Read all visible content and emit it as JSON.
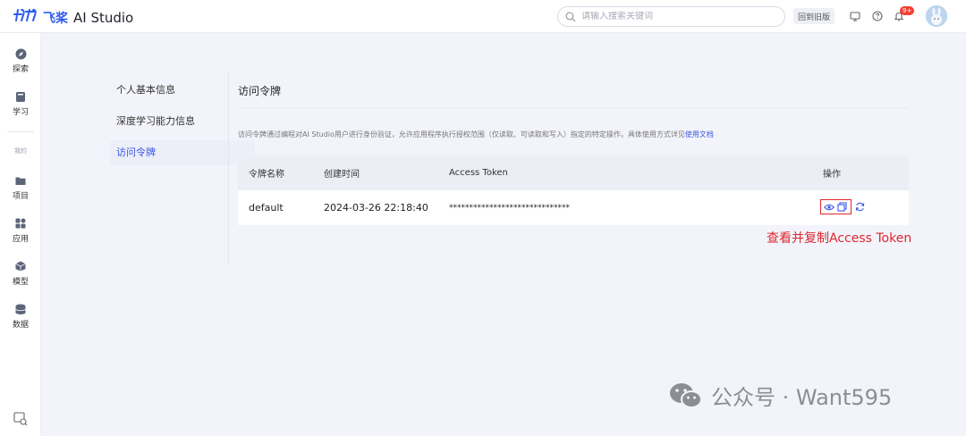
{
  "header": {
    "logo_mark": "ꀘ",
    "logo_cn": "飞桨",
    "app_name": "AI Studio",
    "search_placeholder": "请输入搜索关键词",
    "old_version_label": "回到旧版",
    "notification_badge": "9+"
  },
  "sidebar": {
    "items": [
      {
        "label": "探索",
        "icon": "compass-icon"
      },
      {
        "label": "学习",
        "icon": "book-icon"
      },
      {
        "label": "项目",
        "icon": "folder-icon"
      },
      {
        "label": "应用",
        "icon": "grid-icon"
      },
      {
        "label": "模型",
        "icon": "cube-icon"
      },
      {
        "label": "数据",
        "icon": "database-icon"
      }
    ],
    "section_label": "我的"
  },
  "subnav": {
    "items": [
      {
        "label": "个人基本信息"
      },
      {
        "label": "深度学习能力信息"
      },
      {
        "label": "访问令牌"
      }
    ]
  },
  "main": {
    "title": "访问令牌",
    "description": "访问令牌通过编程对AI Studio用户进行身份验证，允许应用程序执行授权范围（仅读取、可读取和写入）指定的特定操作。具体使用方式详见",
    "doc_link": "使用文档"
  },
  "table": {
    "headers": [
      "令牌名称",
      "创建时间",
      "Access Token",
      "操作"
    ],
    "rows": [
      {
        "name": "default",
        "created": "2024-03-26 22:18:40",
        "token": "******************************"
      }
    ]
  },
  "annotation": "查看并复制Access Token",
  "watermark": "公众号 · Want595",
  "colors": {
    "accent": "#3b55e6",
    "highlight_red": "#e0262e",
    "background": "#f3f4fb"
  }
}
